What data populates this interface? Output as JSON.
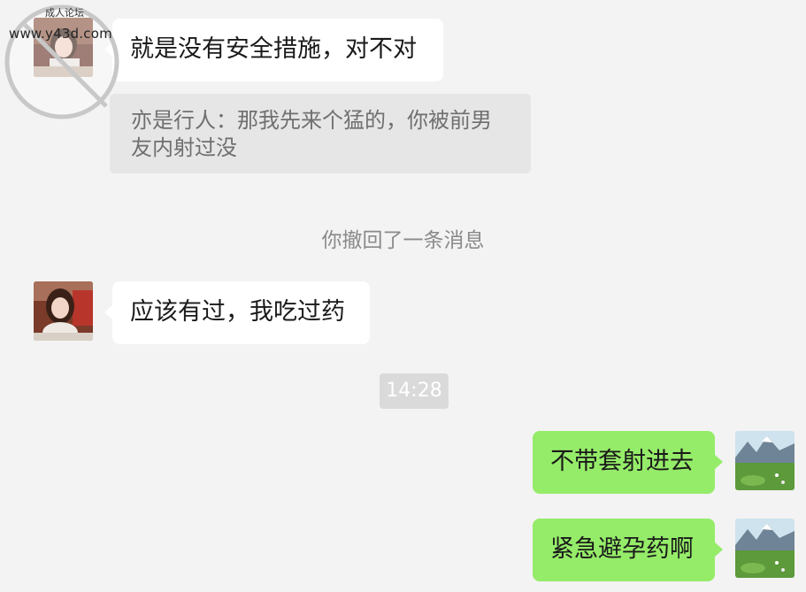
{
  "messages": {
    "msg1": {
      "text": "就是没有安全措施，对不对"
    },
    "quote": {
      "text": "亦是行人：那我先来个猛的，你被前男友内射过没"
    },
    "recall_notice": "你撤回了一条消息",
    "msg2": {
      "text": "应该有过，我吃过药"
    },
    "timestamp": "14:28",
    "msg3": {
      "text": "不带套射进去"
    },
    "msg4": {
      "text": "紧急避孕药啊"
    }
  },
  "watermark": {
    "label": "成人论坛",
    "url": "www.y43d.com"
  },
  "colors": {
    "background": "#f3f3f3",
    "sent_bubble": "#95ec69",
    "received_bubble": "#ffffff",
    "quote_bg": "#e6e6e6",
    "system_text": "#8a8a8a"
  },
  "icons": {
    "contact_avatar": "woman-portrait-avatar",
    "self_avatar": "mountain-meadow-avatar"
  }
}
